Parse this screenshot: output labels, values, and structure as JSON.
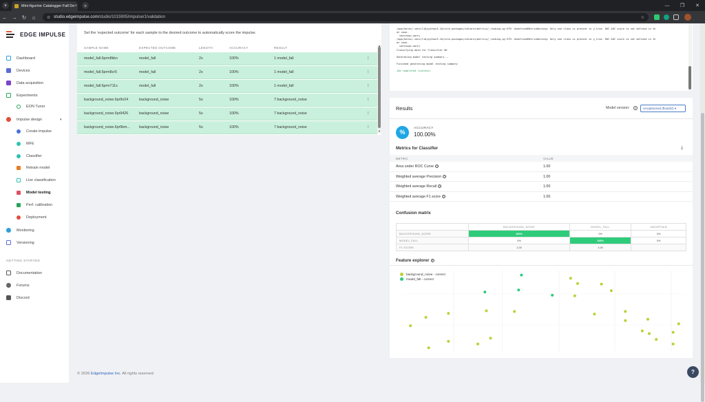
{
  "browser": {
    "tab_title": "Mini-figurine Catalogger Fall De",
    "tab_close": "×",
    "new_tab": "+",
    "url_host": "studio.edgeimpulse.com",
    "url_path": "/studio/1015905/impulse/1/validation",
    "nav_back": "←",
    "nav_forward": "→",
    "nav_reload": "↻",
    "nav_home": "⌂",
    "star": "☆",
    "window_controls": [
      "—",
      "❐",
      "✕"
    ]
  },
  "sidebar": {
    "logo_text": "EDGE IMPULSE",
    "items": [
      {
        "label": "Dashboard",
        "icon": "monitor-icon",
        "color": "#2f9fd8"
      },
      {
        "label": "Devices",
        "icon": "device-icon",
        "color": "#5b6bd6"
      },
      {
        "label": "Data acquisition",
        "icon": "database-icon",
        "color": "#7b45c9"
      },
      {
        "label": "Experiments",
        "icon": "experiments-icon",
        "color": "#2aa35a"
      },
      {
        "label": "EON Tuner",
        "icon": "tuner-icon",
        "color": "#2aa35a"
      },
      {
        "label": "Impulse design",
        "icon": "impulse-icon",
        "color": "#e04e3a"
      },
      {
        "label": "Create impulse",
        "icon": "dot-icon",
        "color": "#4b6fd6"
      },
      {
        "label": "MFE",
        "icon": "dot-icon",
        "color": "#2fc2b0"
      },
      {
        "label": "Classifier",
        "icon": "dot-icon",
        "color": "#2fc2b0"
      },
      {
        "label": "Retrain model",
        "icon": "retrain-icon",
        "color": "#e67e22"
      },
      {
        "label": "Live classification",
        "icon": "live-icon",
        "color": "#2fc2b0"
      },
      {
        "label": "Model testing",
        "icon": "testing-icon",
        "color": "#e04e6a"
      },
      {
        "label": "Perf. calibration",
        "icon": "calibration-icon",
        "color": "#2aa35a"
      },
      {
        "label": "Deployment",
        "icon": "deployment-icon",
        "color": "#e04e3a"
      },
      {
        "label": "Monitoring",
        "icon": "monitoring-icon",
        "color": "#2f9fd8"
      },
      {
        "label": "Versioning",
        "icon": "versioning-icon",
        "color": "#5b6bd6"
      }
    ],
    "getting_started_label": "GETTING STARTED",
    "help_items": [
      {
        "label": "Documentation",
        "icon": "book-icon"
      },
      {
        "label": "Forums",
        "icon": "forum-icon"
      },
      {
        "label": "Discord",
        "icon": "discord-icon"
      }
    ],
    "caret": "▾"
  },
  "samples": {
    "intro": "Set the 'expected outcome' for each sample to the desired outcome to automatically score the impulse.",
    "columns": [
      "SAMPLE NAME",
      "EXPECTED OUTCOME",
      "LENGTH",
      "ACCURACY",
      "RESULT"
    ],
    "rows": [
      {
        "name": "model_fall.6prm8kkn",
        "expected": "model_fall",
        "length": "2s",
        "accuracy": "100%",
        "result": "1 model_fall"
      },
      {
        "name": "model_fall.6prm8cr5",
        "expected": "model_fall",
        "length": "2s",
        "accuracy": "100%",
        "result": "1 model_fall"
      },
      {
        "name": "model_fall.6prm711s",
        "expected": "model_fall",
        "length": "2s",
        "accuracy": "100%",
        "result": "1 model_fall"
      },
      {
        "name": "background_noise.6pr9n24",
        "expected": "background_noise",
        "length": "5s",
        "accuracy": "100%",
        "result": "7 background_noise"
      },
      {
        "name": "background_noise.6pr9426",
        "expected": "background_noise",
        "length": "5s",
        "accuracy": "100%",
        "result": "7 background_noise"
      },
      {
        "name": "background_noise.6pr9km...",
        "expected": "background_noise",
        "length": "5s",
        "accuracy": "100%",
        "result": "7 background_noise"
      }
    ],
    "row_menu": "⋮",
    "scroll_up": "▲",
    "scroll_down": "▼"
  },
  "log": {
    "lines": [
      "/app/keras/.venv/lib/python3.10/site-packages/sklearn/metrics/_ranking.py:379: UndefinedMetricWarning: Only one class is present in y_true. ROC AUC score is not defined in th",
      "at case.",
      "  warnings.warn(",
      "/app/keras/.venv/lib/python3.10/site-packages/sklearn/metrics/_ranking.py:379: UndefinedMetricWarning: Only one class is present in y_true. ROC AUC score is not defined in th",
      "at case.",
      "  warnings.warn(",
      "Classifying data for Classifier OK",
      "",
      "Generating model testing summary...",
      "",
      "Finished generating model testing summary",
      ""
    ],
    "success_line": "Job completed (success)"
  },
  "results": {
    "title": "Results",
    "model_version_label": "Model version:",
    "model_version_value": "Unoptimized (float32) ▾",
    "accuracy_label": "ACCURACY",
    "accuracy_value": "100.00%",
    "accuracy_icon": "%",
    "metrics_title": "Metrics for Classifier",
    "download_icon": "⤓",
    "metric_col": "METRIC",
    "value_col": "VALUE",
    "metrics": [
      {
        "label": "Area under ROC Curve",
        "value": "1.00"
      },
      {
        "label": "Weighted average Precision",
        "value": "1.00"
      },
      {
        "label": "Weighted average Recall",
        "value": "1.00"
      },
      {
        "label": "Weighted average F1 score",
        "value": "1.00"
      }
    ],
    "help_glyph": "?",
    "confusion_title": "Confusion matrix",
    "confusion": {
      "columns": [
        "BACKGROUND_NOISE",
        "MODEL_FALL",
        "UNCERTAIN"
      ],
      "rows": [
        {
          "label": "BACKGROUND_NOISE",
          "cells": [
            "100%",
            "0%",
            "0%"
          ]
        },
        {
          "label": "MODEL_FALL",
          "cells": [
            "0%",
            "100%",
            "0%"
          ]
        }
      ],
      "f1_label": "F1 SCORE",
      "f1": [
        "1.00",
        "1.00",
        ""
      ]
    },
    "feature_title": "Feature explorer",
    "legend": [
      {
        "label": "background_noise - correct",
        "color": "#b5d334"
      },
      {
        "label": "model_fall - correct",
        "color": "#2ecc7a"
      }
    ]
  },
  "chart_data": {
    "type": "scatter",
    "series": [
      {
        "name": "background_noise - correct",
        "color": "#b5d334",
        "points": [
          [
            -0.95,
            0.1
          ],
          [
            -0.84,
            0.23
          ],
          [
            -0.68,
            0.29
          ],
          [
            -0.82,
            -0.24
          ],
          [
            -0.68,
            -0.14
          ],
          [
            -0.47,
            -0.18
          ],
          [
            -0.38,
            -0.09
          ],
          [
            -0.21,
            0.32
          ],
          [
            -0.41,
            0.33
          ],
          [
            0.19,
            0.83
          ],
          [
            0.22,
            0.56
          ],
          [
            0.24,
            0.75
          ],
          [
            0.36,
            0.28
          ],
          [
            0.41,
            0.74
          ],
          [
            0.48,
            0.64
          ],
          [
            0.58,
            0.32
          ],
          [
            0.58,
            0.18
          ],
          [
            0.74,
            0.2
          ],
          [
            0.7,
            0.02
          ],
          [
            0.75,
            -0.02
          ],
          [
            0.8,
            -0.11
          ],
          [
            0.92,
            0.0
          ],
          [
            0.92,
            -0.18
          ],
          [
            0.96,
            0.13
          ]
        ]
      },
      {
        "name": "model_fall - correct",
        "color": "#2ecc7a",
        "points": [
          [
            -0.16,
            0.88
          ],
          [
            -0.18,
            0.65
          ],
          [
            -0.42,
            0.62
          ],
          [
            0.06,
            0.57
          ]
        ]
      }
    ]
  },
  "footer": {
    "prefix": "© 2026 ",
    "link": "EdgeImpulse Inc.",
    "suffix": " All rights reserved"
  },
  "help_fab": "?"
}
